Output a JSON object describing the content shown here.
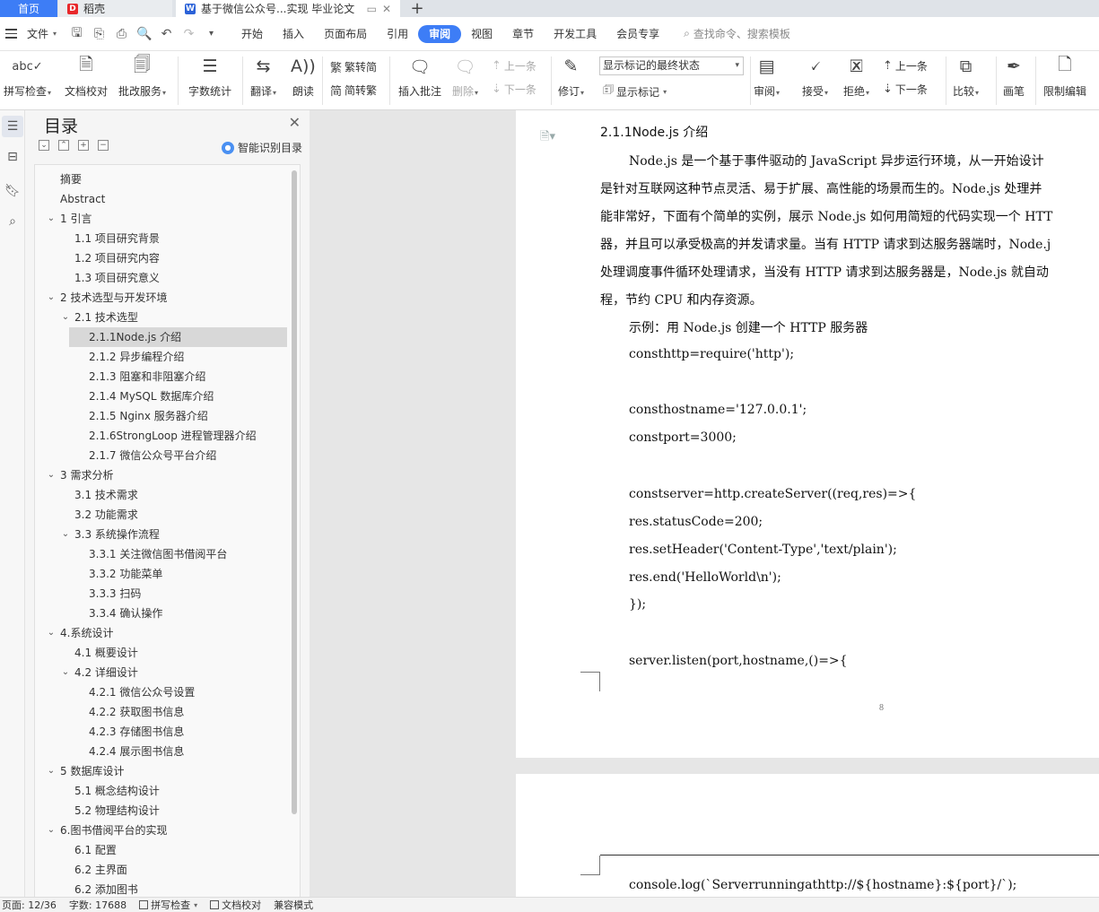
{
  "tabs": {
    "home": "首页",
    "docer": "稻壳",
    "doc": "基于微信公众号...实现 毕业论文",
    "new_tab": "+"
  },
  "menu": {
    "file": "文件",
    "items": [
      "开始",
      "插入",
      "页面布局",
      "引用",
      "审阅",
      "视图",
      "章节",
      "开发工具",
      "会员专享"
    ],
    "active": "审阅",
    "search_placeholder": "查找命令、搜索模板"
  },
  "ribbon": {
    "spell_check": "拼写检查",
    "doc_proof": "文档校对",
    "batch_service": "批改服务",
    "word_count": "字数统计",
    "translate": "翻译",
    "read_aloud": "朗读",
    "to_traditional": "繁转简",
    "to_simplified": "简转繁",
    "insert_comment": "插入批注",
    "delete": "删除",
    "prev_comment": "上一条",
    "next_comment": "下一条",
    "track_changes": "修订",
    "markup_select": "显示标记的最终状态",
    "show_markup": "显示标记",
    "review": "审阅",
    "accept": "接受",
    "reject": "拒绝",
    "prev_change": "上一条",
    "next_change": "下一条",
    "compare": "比较",
    "ink": "画笔",
    "restrict_edit": "限制编辑"
  },
  "toc": {
    "title": "目录",
    "smart": "智能识别目录",
    "items": [
      {
        "label": "摘要",
        "level": 0,
        "arrow": false
      },
      {
        "label": "Abstract",
        "level": 0,
        "arrow": false
      },
      {
        "label": "1 引言",
        "level": 0,
        "arrow": true
      },
      {
        "label": "1.1 项目研究背景",
        "level": 1,
        "arrow": false
      },
      {
        "label": "1.2 项目研究内容",
        "level": 1,
        "arrow": false
      },
      {
        "label": "1.3 项目研究意义",
        "level": 1,
        "arrow": false
      },
      {
        "label": "2 技术选型与开发环境",
        "level": 0,
        "arrow": true
      },
      {
        "label": "2.1 技术选型",
        "level": 1,
        "arrow": true
      },
      {
        "label": "2.1.1Node.js 介绍",
        "level": 2,
        "arrow": false,
        "selected": true
      },
      {
        "label": "2.1.2 异步编程介绍",
        "level": 2,
        "arrow": false
      },
      {
        "label": "2.1.3 阻塞和非阻塞介绍",
        "level": 2,
        "arrow": false
      },
      {
        "label": "2.1.4 MySQL 数据库介绍",
        "level": 2,
        "arrow": false
      },
      {
        "label": "2.1.5 Nginx 服务器介绍",
        "level": 2,
        "arrow": false
      },
      {
        "label": "2.1.6StrongLoop 进程管理器介绍",
        "level": 2,
        "arrow": false
      },
      {
        "label": "2.1.7 微信公众号平台介绍",
        "level": 2,
        "arrow": false
      },
      {
        "label": "3 需求分析",
        "level": 0,
        "arrow": true
      },
      {
        "label": "3.1 技术需求",
        "level": 1,
        "arrow": false
      },
      {
        "label": "3.2 功能需求",
        "level": 1,
        "arrow": false
      },
      {
        "label": "3.3 系统操作流程",
        "level": 1,
        "arrow": true
      },
      {
        "label": "3.3.1 关注微信图书借阅平台",
        "level": 2,
        "arrow": false
      },
      {
        "label": "3.3.2 功能菜单",
        "level": 2,
        "arrow": false
      },
      {
        "label": "3.3.3 扫码",
        "level": 2,
        "arrow": false
      },
      {
        "label": "3.3.4 确认操作",
        "level": 2,
        "arrow": false
      },
      {
        "label": "4.系统设计",
        "level": 0,
        "arrow": true
      },
      {
        "label": "4.1 概要设计",
        "level": 1,
        "arrow": false
      },
      {
        "label": "4.2 详细设计",
        "level": 1,
        "arrow": true
      },
      {
        "label": "4.2.1 微信公众号设置",
        "level": 2,
        "arrow": false
      },
      {
        "label": "4.2.2 获取图书信息",
        "level": 2,
        "arrow": false
      },
      {
        "label": "4.2.3 存储图书信息",
        "level": 2,
        "arrow": false
      },
      {
        "label": "4.2.4 展示图书信息",
        "level": 2,
        "arrow": false
      },
      {
        "label": "5 数据库设计",
        "level": 0,
        "arrow": true
      },
      {
        "label": "5.1 概念结构设计",
        "level": 1,
        "arrow": false
      },
      {
        "label": "5.2 物理结构设计",
        "level": 1,
        "arrow": false
      },
      {
        "label": "6.图书借阅平台的实现",
        "level": 0,
        "arrow": true
      },
      {
        "label": "6.1 配置",
        "level": 1,
        "arrow": false
      },
      {
        "label": "6.2 主界面",
        "level": 1,
        "arrow": false
      },
      {
        "label": "6.2 添加图书",
        "level": 1,
        "arrow": false
      }
    ]
  },
  "document": {
    "heading": "2.1.1Node.js 介绍",
    "para": [
      "Node.js 是一个基于事件驱动的 JavaScript 异步运行环境，从一开始设计",
      "是针对互联网这种节点灵活、易于扩展、高性能的场景而生的。Node.js 处理并",
      "能非常好，下面有个简单的实例，展示 Node.js 如何用简短的代码实现一个 HTT",
      "器，并且可以承受极高的并发请求量。当有 HTTP 请求到达服务器端时，Node.j",
      "处理调度事件循环处理请求，当没有 HTTP 请求到达服务器是，Node.js 就自动",
      "程，节约 CPU 和内存资源。"
    ],
    "example": "示例：用 Node.js 创建一个 HTTP 服务器",
    "code": [
      "consthttp=require('http');",
      "consthostname='127.0.0.1';",
      "constport=3000;",
      "constserver=http.createServer((req,res)=>{",
      "res.statusCode=200;",
      "res.setHeader('Content-Type','text/plain');",
      "res.end('HelloWorld\\n');",
      "});",
      "server.listen(port,hostname,()=>{",
      "console.log(`Serverrunningathttp://${hostname}:${port}/`);"
    ],
    "page_number": "8"
  },
  "status": {
    "page": "页面: 12/36",
    "words": "字数: 17688",
    "spell": "拼写检查",
    "proof": "文档校对",
    "mode": "兼容模式"
  }
}
